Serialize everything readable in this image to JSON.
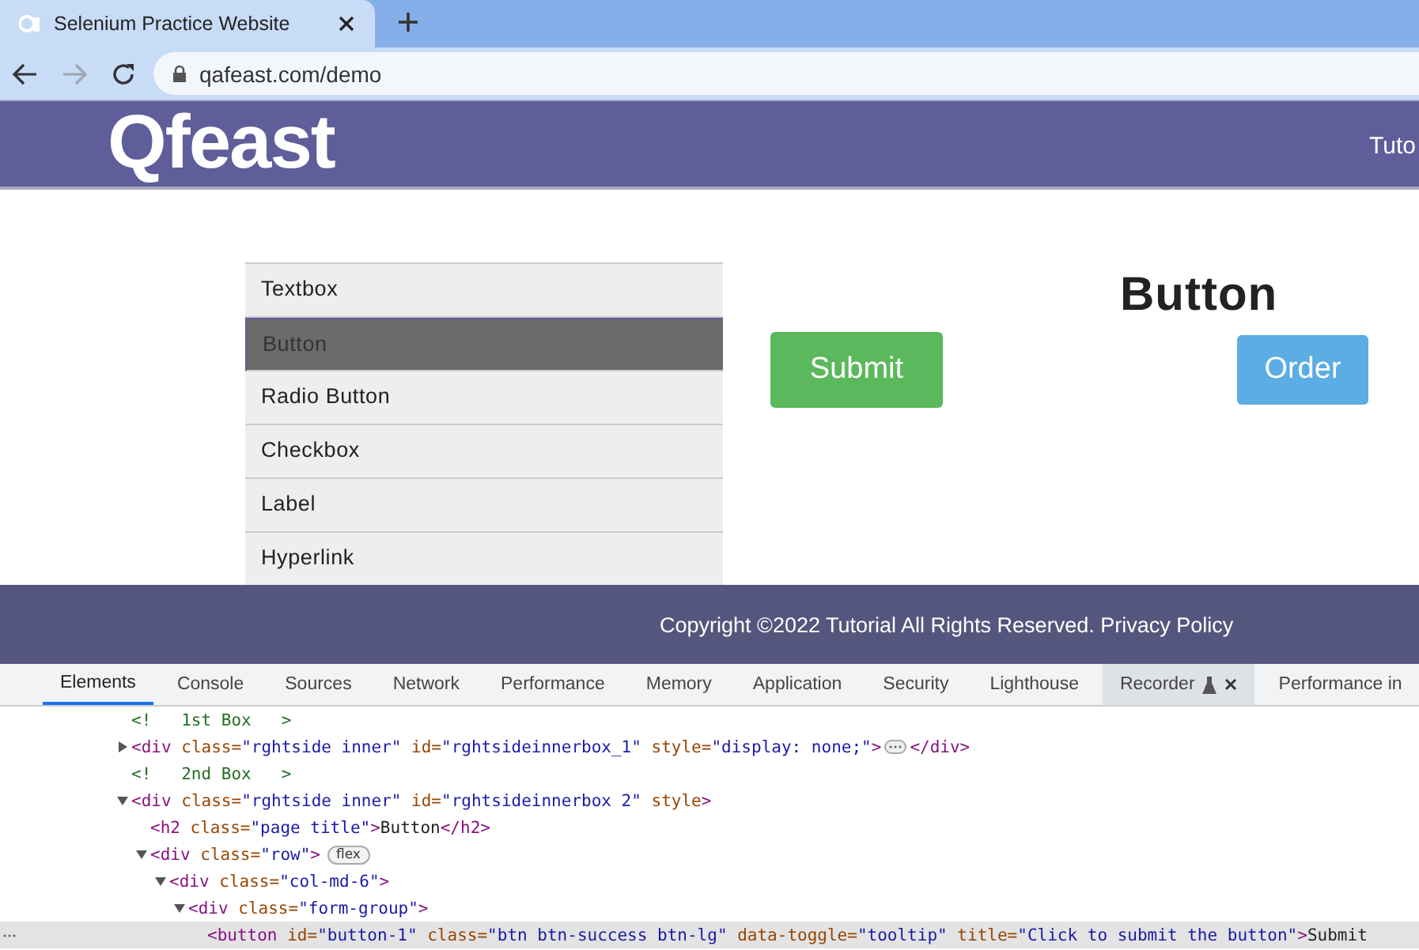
{
  "browser": {
    "tab": {
      "title": "Selenium Practice Website"
    },
    "address": "qafeast.com/demo",
    "forward_disabled": true
  },
  "site": {
    "logo": "Qfeast",
    "nav": [
      "Tuto"
    ],
    "sidebar": [
      {
        "label": "Textbox",
        "selected": false
      },
      {
        "label": "Button",
        "selected": true
      },
      {
        "label": "Radio Button",
        "selected": false
      },
      {
        "label": "Checkbox",
        "selected": false
      },
      {
        "label": "Label",
        "selected": false
      },
      {
        "label": "Hyperlink",
        "selected": false
      }
    ],
    "title": "Button",
    "buttons": [
      {
        "label": "Submit",
        "kind": "success"
      },
      {
        "label": "Order",
        "kind": "info"
      }
    ],
    "footer": {
      "text": "Copyright ©2022 Tutorial All Rights Reserved. ",
      "link": "Privacy Policy"
    }
  },
  "devtools": {
    "tabs": [
      {
        "label": "Elements",
        "selected": true,
        "closable": false
      },
      {
        "label": "Console",
        "selected": false,
        "closable": false
      },
      {
        "label": "Sources",
        "selected": false,
        "closable": false
      },
      {
        "label": "Network",
        "selected": false,
        "closable": false
      },
      {
        "label": "Performance",
        "selected": false,
        "closable": false
      },
      {
        "label": "Memory",
        "selected": false,
        "closable": false
      },
      {
        "label": "Application",
        "selected": false,
        "closable": false
      },
      {
        "label": "Security",
        "selected": false,
        "closable": false
      },
      {
        "label": "Lighthouse",
        "selected": false,
        "closable": false
      },
      {
        "label": "Recorder",
        "selected": false,
        "closable": true
      },
      {
        "label": "Performance in",
        "selected": false,
        "closable": false
      }
    ],
    "dom": [
      {
        "kind": "comment",
        "selected": false,
        "tokens": [
          {
            "kind": "comment",
            "text": "<!   1st Box   >"
          }
        ]
      },
      {
        "kind": "element",
        "expanded": false,
        "selected": false,
        "tokens": [
          {
            "kind": "tag",
            "text": "<div"
          },
          {
            "kind": "attr",
            "text": " class="
          },
          {
            "kind": "value",
            "text": "\"rghtside inner\""
          },
          {
            "kind": "attr",
            "text": " id="
          },
          {
            "kind": "value",
            "text": "\"rghtsideinnerbox_1\""
          },
          {
            "kind": "attr",
            "text": " style="
          },
          {
            "kind": "value",
            "text": "\"display: none;\""
          },
          {
            "kind": "tag",
            "text": ">"
          },
          {
            "kind": "ellipsis"
          },
          {
            "kind": "tag",
            "text": "</div>"
          }
        ]
      },
      {
        "kind": "comment",
        "selected": false,
        "tokens": [
          {
            "kind": "comment",
            "text": "<!   2nd Box   >"
          }
        ]
      },
      {
        "kind": "element",
        "expanded": true,
        "selected": false,
        "tokens": [
          {
            "kind": "tag",
            "text": "<div"
          },
          {
            "kind": "attr",
            "text": " class="
          },
          {
            "kind": "value",
            "text": "\"rghtside inner\""
          },
          {
            "kind": "attr",
            "text": " id="
          },
          {
            "kind": "value",
            "text": "\"rghtsideinnerbox 2\""
          },
          {
            "kind": "attr",
            "text": " style"
          },
          {
            "kind": "tag",
            "text": ">"
          }
        ],
        "children": [
          {
            "kind": "leaf",
            "selected": false,
            "tokens": [
              {
                "kind": "tag",
                "text": "<h2"
              },
              {
                "kind": "attr",
                "text": " class="
              },
              {
                "kind": "value",
                "text": "\"page title\""
              },
              {
                "kind": "tag",
                "text": ">"
              },
              {
                "kind": "text",
                "text": "Button"
              },
              {
                "kind": "tag",
                "text": "</h2>"
              }
            ]
          },
          {
            "kind": "element",
            "expanded": true,
            "selected": false,
            "tokens": [
              {
                "kind": "tag",
                "text": "<div"
              },
              {
                "kind": "attr",
                "text": " class="
              },
              {
                "kind": "value",
                "text": "\"row\""
              },
              {
                "kind": "tag",
                "text": ">"
              },
              {
                "kind": "badge",
                "text": "flex"
              }
            ],
            "children": [
              {
                "kind": "element",
                "expanded": true,
                "selected": false,
                "tokens": [
                  {
                    "kind": "tag",
                    "text": "<div"
                  },
                  {
                    "kind": "attr",
                    "text": " class="
                  },
                  {
                    "kind": "value",
                    "text": "\"col-md-6\""
                  },
                  {
                    "kind": "tag",
                    "text": ">"
                  }
                ],
                "children": [
                  {
                    "kind": "element",
                    "expanded": true,
                    "selected": false,
                    "tokens": [
                      {
                        "kind": "tag",
                        "text": "<div"
                      },
                      {
                        "kind": "attr",
                        "text": " class="
                      },
                      {
                        "kind": "value",
                        "text": "\"form-group\""
                      },
                      {
                        "kind": "tag",
                        "text": ">"
                      }
                    ],
                    "children": [
                      {
                        "kind": "leaf",
                        "selected": true,
                        "tokens": [
                          {
                            "kind": "tag",
                            "text": "<button"
                          },
                          {
                            "kind": "attr",
                            "text": " id="
                          },
                          {
                            "kind": "value",
                            "text": "\"button-1\""
                          },
                          {
                            "kind": "attr",
                            "text": " class="
                          },
                          {
                            "kind": "value",
                            "text": "\"btn btn-success btn-lg\""
                          },
                          {
                            "kind": "attr",
                            "text": " data-toggle="
                          },
                          {
                            "kind": "value",
                            "text": "\"tooltip\""
                          },
                          {
                            "kind": "attr",
                            "text": " title="
                          },
                          {
                            "kind": "value",
                            "text": "\"Click to submit the button\""
                          },
                          {
                            "kind": "tag",
                            "text": ">"
                          },
                          {
                            "kind": "text",
                            "text": "Submit"
                          }
                        ]
                      }
                    ]
                  }
                ]
              }
            ]
          }
        ]
      }
    ]
  }
}
